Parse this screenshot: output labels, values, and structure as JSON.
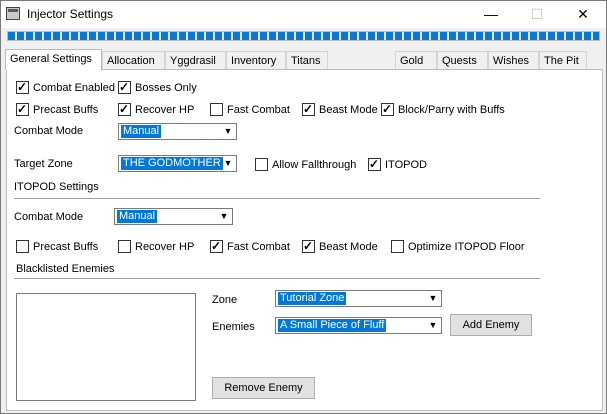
{
  "window": {
    "title": "Injector Settings",
    "controls": {
      "minimize": "—",
      "maximize": "☐",
      "close": "✕"
    }
  },
  "progress": {
    "value": 1.0
  },
  "tabs": [
    {
      "label": "General Settings",
      "active": true
    },
    {
      "label": "Allocation"
    },
    {
      "label": "Yggdrasil"
    },
    {
      "label": "Inventory"
    },
    {
      "label": "Titans"
    },
    {
      "label": "Gold"
    },
    {
      "label": "Quests"
    },
    {
      "label": "Wishes"
    },
    {
      "label": "The Pit"
    }
  ],
  "general": {
    "combat_enabled": {
      "label": "Combat Enabled",
      "checked": true
    },
    "bosses_only": {
      "label": "Bosses Only",
      "checked": true
    },
    "precast_buffs": {
      "label": "Precast Buffs",
      "checked": true
    },
    "recover_hp": {
      "label": "Recover HP",
      "checked": true
    },
    "fast_combat": {
      "label": "Fast Combat",
      "checked": false
    },
    "beast_mode": {
      "label": "Beast Mode",
      "checked": true
    },
    "block_parry": {
      "label": "Block/Parry with Buffs",
      "checked": true
    },
    "combat_mode_label": "Combat Mode",
    "combat_mode_value": "Manual",
    "target_zone_label": "Target Zone",
    "target_zone_value": "THE GODMOTHER",
    "allow_fallthrough": {
      "label": "Allow Fallthrough",
      "checked": false
    },
    "itopod": {
      "label": "ITOPOD",
      "checked": true
    }
  },
  "itopod_settings": {
    "heading": "ITOPOD Settings",
    "combat_mode_label": "Combat Mode",
    "combat_mode_value": "Manual",
    "precast_buffs": {
      "label": "Precast Buffs",
      "checked": false
    },
    "recover_hp": {
      "label": "Recover HP",
      "checked": false
    },
    "fast_combat": {
      "label": "Fast Combat",
      "checked": true
    },
    "beast_mode": {
      "label": "Beast Mode",
      "checked": true
    },
    "optimize_floor": {
      "label": "Optimize ITOPOD Floor",
      "checked": false
    }
  },
  "blacklist": {
    "heading": "Blacklisted Enemies",
    "zone_label": "Zone",
    "zone_value": "Tutorial Zone",
    "enemies_label": "Enemies",
    "enemies_value": "A Small Piece of Fluff",
    "add_button": "Add Enemy",
    "remove_button": "Remove Enemy"
  }
}
